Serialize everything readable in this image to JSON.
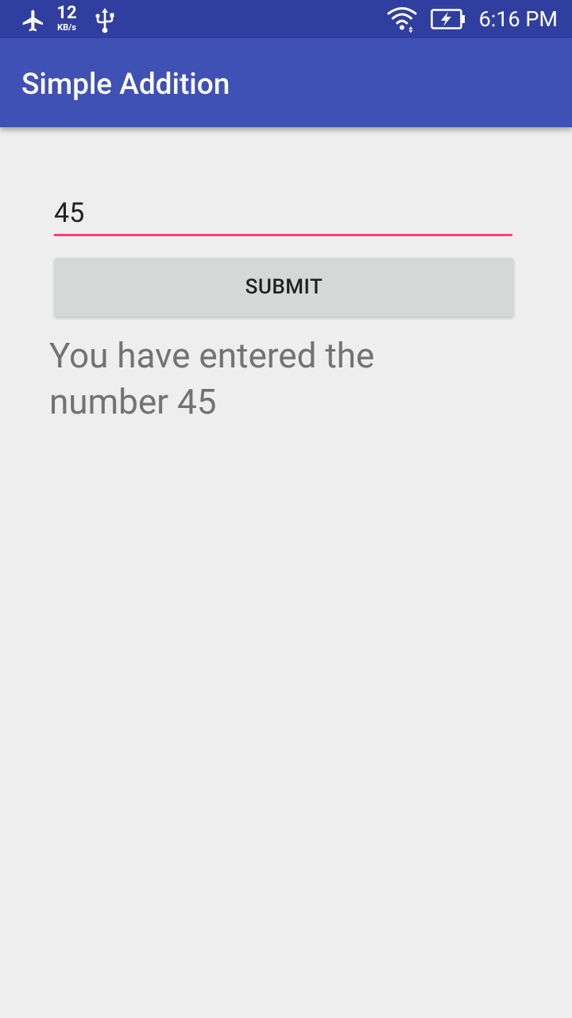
{
  "status_bar": {
    "network_speed": "12",
    "network_speed_unit": "KB/s",
    "time": "6:16 PM",
    "icons": [
      "airplane-mode-icon",
      "usb-icon",
      "wifi-icon",
      "battery-charging-icon"
    ]
  },
  "app_bar": {
    "title": "Simple Addition"
  },
  "form": {
    "input_value": "45",
    "submit_label": "SUBMIT",
    "result_text": "You have entered the number 45"
  },
  "colors": {
    "status_bar": "#303f9f",
    "app_bar": "#3f51b5",
    "accent": "#ff4081",
    "background": "#eeeeee",
    "button": "#d6d7d7"
  }
}
